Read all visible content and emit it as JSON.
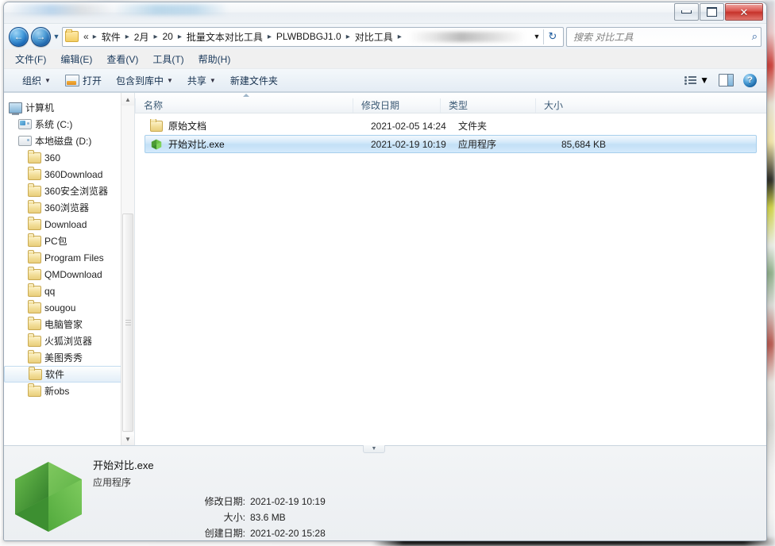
{
  "window": {
    "controls": {
      "minimize": "—",
      "maximize": "❐",
      "close": "✕"
    }
  },
  "address": {
    "back_glyph": "←",
    "forward_glyph": "→",
    "history_glyph": "▼",
    "double_chevron": "«",
    "crumbs": [
      "软件",
      "2月",
      "20",
      "批量文本对比工具",
      "PLWBDBGJ1.0",
      "对比工具"
    ],
    "chevron": "▸",
    "dropdown_glyph": "▼",
    "refresh_glyph": "↻"
  },
  "search": {
    "placeholder": "搜索 对比工具",
    "icon_glyph": "⌕"
  },
  "menubar": {
    "items": [
      "文件(F)",
      "编辑(E)",
      "查看(V)",
      "工具(T)",
      "帮助(H)"
    ]
  },
  "toolbar": {
    "organize": "组织",
    "open": "打开",
    "include_library": "包含到库中",
    "share": "共享",
    "new_folder": "新建文件夹",
    "caret": "▼",
    "help_glyph": "?"
  },
  "sidebar": {
    "items": [
      {
        "label": "计算机",
        "icon": "computer-icon",
        "level": 0,
        "selected": false
      },
      {
        "label": "系统 (C:)",
        "icon": "drive-windows-icon",
        "level": 1,
        "selected": false
      },
      {
        "label": "本地磁盘 (D:)",
        "icon": "drive-icon",
        "level": 1,
        "selected": false
      },
      {
        "label": "360",
        "icon": "folder-icon",
        "level": 2,
        "selected": false
      },
      {
        "label": "360Download",
        "icon": "folder-icon",
        "level": 2,
        "selected": false
      },
      {
        "label": "360安全浏览器",
        "icon": "folder-icon",
        "level": 2,
        "selected": false
      },
      {
        "label": "360浏览器",
        "icon": "folder-icon",
        "level": 2,
        "selected": false
      },
      {
        "label": "Download",
        "icon": "folder-icon",
        "level": 2,
        "selected": false
      },
      {
        "label": "PC包",
        "icon": "folder-icon",
        "level": 2,
        "selected": false
      },
      {
        "label": "Program Files",
        "icon": "folder-icon",
        "level": 2,
        "selected": false
      },
      {
        "label": "QMDownload",
        "icon": "folder-icon",
        "level": 2,
        "selected": false
      },
      {
        "label": "qq",
        "icon": "folder-icon",
        "level": 2,
        "selected": false
      },
      {
        "label": "sougou",
        "icon": "folder-icon",
        "level": 2,
        "selected": false
      },
      {
        "label": "电脑管家",
        "icon": "folder-icon",
        "level": 2,
        "selected": false
      },
      {
        "label": "火狐浏览器",
        "icon": "folder-icon",
        "level": 2,
        "selected": false
      },
      {
        "label": "美图秀秀",
        "icon": "folder-icon",
        "level": 2,
        "selected": false
      },
      {
        "label": "软件",
        "icon": "folder-icon",
        "level": 2,
        "selected": true
      },
      {
        "label": "新obs",
        "icon": "folder-icon",
        "level": 2,
        "selected": false
      }
    ],
    "scroll_up_glyph": "▲",
    "scroll_down_glyph": "▼"
  },
  "filelist": {
    "columns": [
      "名称",
      "修改日期",
      "类型",
      "大小"
    ],
    "rows": [
      {
        "name": "原始文档",
        "date": "2021-02-05 14:24",
        "type": "文件夹",
        "size": "",
        "icon": "folder-icon",
        "selected": false
      },
      {
        "name": "开始对比.exe",
        "date": "2021-02-19 10:19",
        "type": "应用程序",
        "size": "85,684 KB",
        "icon": "green-hexagon-app-icon",
        "selected": true
      }
    ]
  },
  "details": {
    "title": "开始对比.exe",
    "subtitle": "应用程序",
    "fields": [
      {
        "key": "修改日期:",
        "value": "2021-02-19 10:19"
      },
      {
        "key": "大小:",
        "value": "83.6 MB"
      },
      {
        "key": "创建日期:",
        "value": "2021-02-20 15:28"
      }
    ],
    "collapse_glyph": "▼"
  },
  "colors": {
    "selection_blue": "#c3e0f6",
    "accent_blue": "#1766b4",
    "app_icon_green": "#4fa83c",
    "close_red": "#c6332b",
    "folder_yellow": "#f2dd97"
  }
}
